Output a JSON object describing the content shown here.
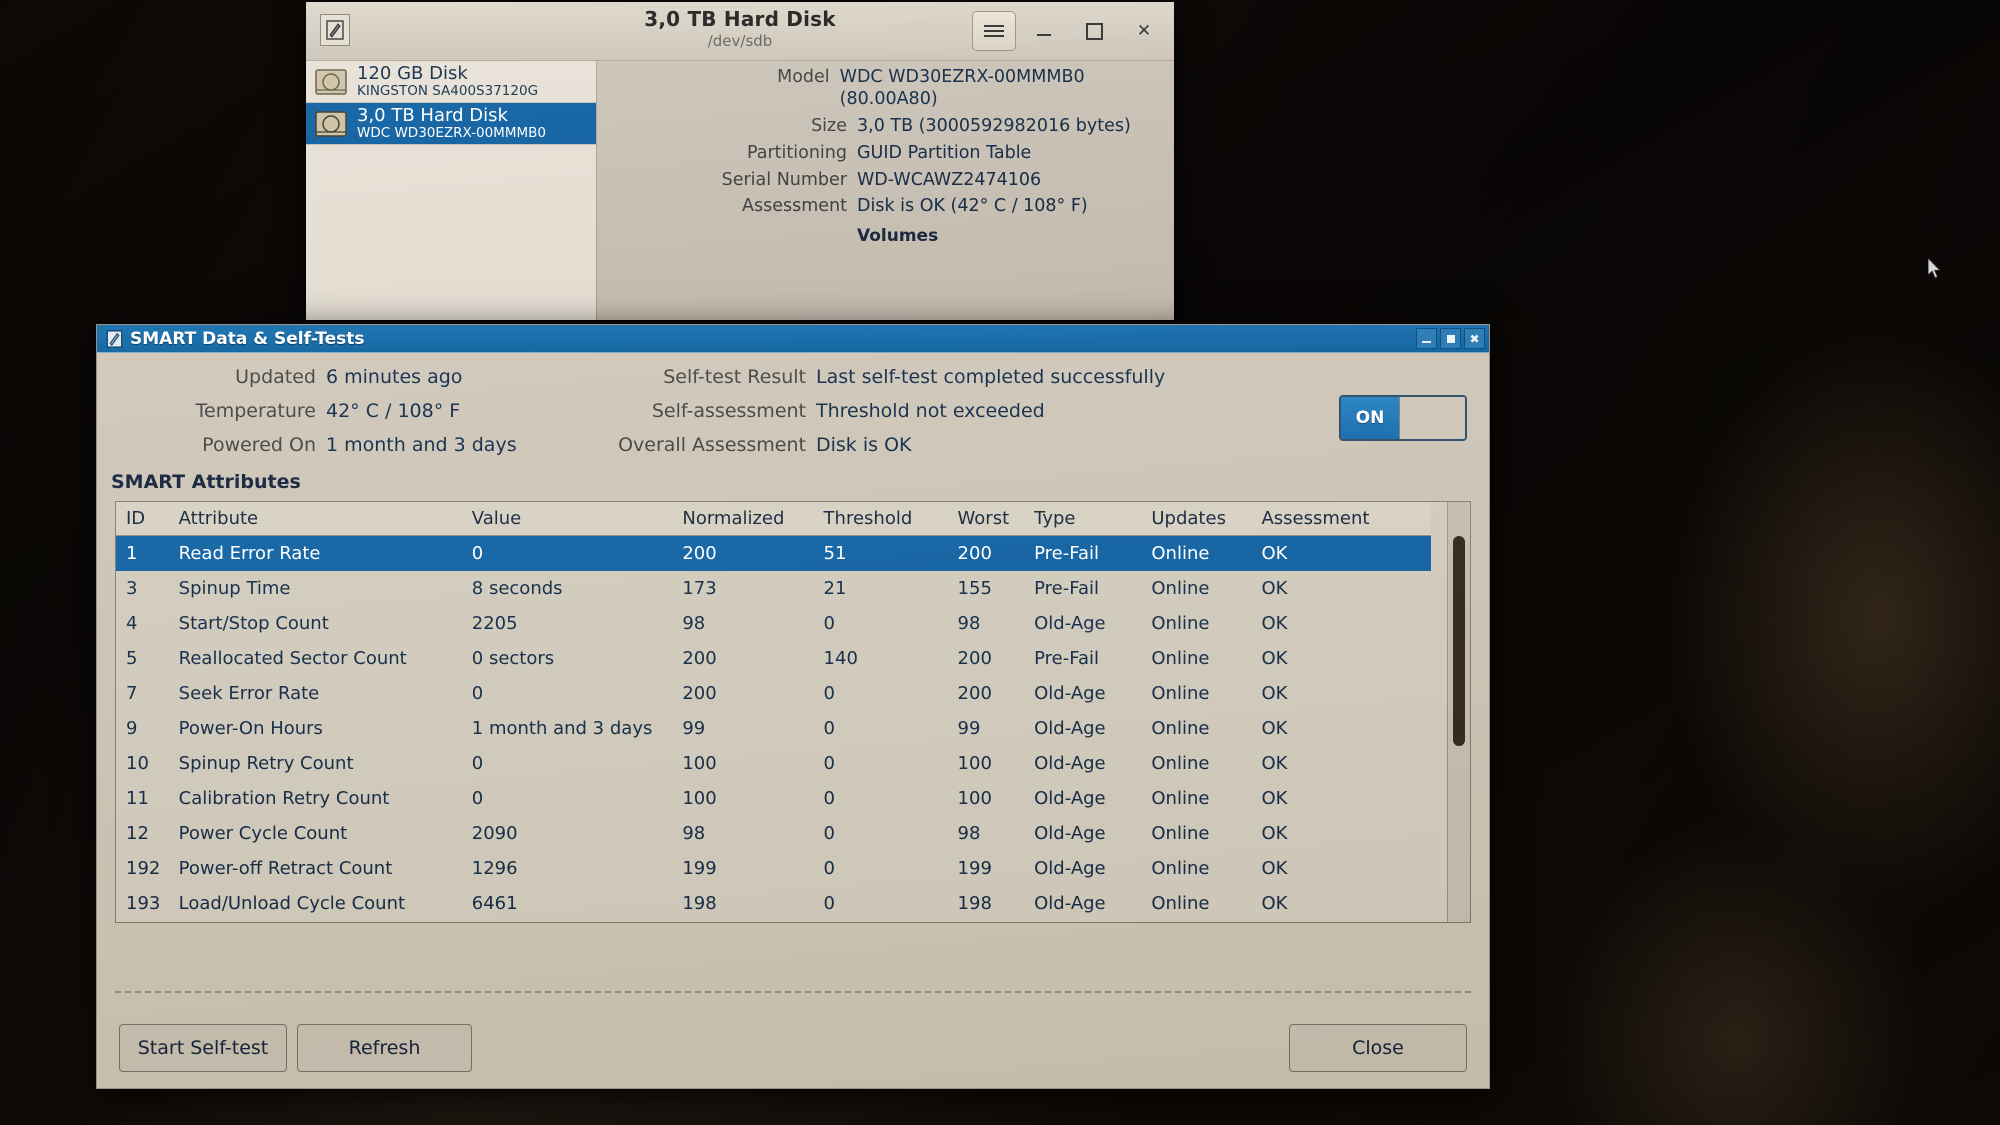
{
  "desktop": {
    "cursor_icon": "mouse-pointer-icon"
  },
  "disks_window": {
    "title": "3,0 TB Hard Disk",
    "subtitle": "/dev/sdb",
    "app_icon": "disks-app-icon",
    "titlebar_buttons": {
      "menu": "hamburger-menu-icon",
      "minimize": "minimize-icon",
      "maximize": "maximize-icon",
      "close": "close-icon"
    },
    "disk_list": [
      {
        "name": "120 GB Disk",
        "model": "KINGSTON SA400S37120G",
        "selected": false,
        "icon": "hard-disk-icon"
      },
      {
        "name": "3,0 TB Hard Disk",
        "model": "WDC WD30EZRX-00MMMB0",
        "selected": true,
        "icon": "hard-disk-icon"
      }
    ],
    "details": [
      {
        "key": "Model",
        "value": "WDC WD30EZRX-00MMMB0 (80.00A80)"
      },
      {
        "key": "Size",
        "value": "3,0 TB (3000592982016 bytes)"
      },
      {
        "key": "Partitioning",
        "value": "GUID Partition Table"
      },
      {
        "key": "Serial Number",
        "value": "WD-WCAWZ2474106"
      },
      {
        "key": "Assessment",
        "value": "Disk is OK (42° C / 108° F)"
      }
    ],
    "volumes_label": "Volumes"
  },
  "smart_dialog": {
    "title": "SMART Data & Self-Tests",
    "title_icon": "disks-app-icon",
    "titlebar_buttons": {
      "minimize": "minimize-icon",
      "maximize": "maximize-icon",
      "close": "close-icon"
    },
    "info_left": [
      {
        "key": "Updated",
        "value": "6 minutes ago"
      },
      {
        "key": "Temperature",
        "value": "42° C / 108° F"
      },
      {
        "key": "Powered On",
        "value": "1 month and 3 days"
      }
    ],
    "info_right": [
      {
        "key": "Self-test Result",
        "value": "Last self-test completed successfully"
      },
      {
        "key": "Self-assessment",
        "value": "Threshold not exceeded"
      },
      {
        "key": "Overall Assessment",
        "value": "Disk is OK"
      }
    ],
    "power_toggle": {
      "state": "ON",
      "on_label": "ON"
    },
    "attributes_heading": "SMART Attributes",
    "table": {
      "columns": [
        "ID",
        "Attribute",
        "Value",
        "Normalized",
        "Threshold",
        "Worst",
        "Type",
        "Updates",
        "Assessment"
      ],
      "rows": [
        {
          "id": "1",
          "attribute": "Read Error Rate",
          "value": "0",
          "normalized": "200",
          "threshold": "51",
          "worst": "200",
          "type": "Pre-Fail",
          "updates": "Online",
          "assessment": "OK",
          "selected": true
        },
        {
          "id": "3",
          "attribute": "Spinup Time",
          "value": "8 seconds",
          "normalized": "173",
          "threshold": "21",
          "worst": "155",
          "type": "Pre-Fail",
          "updates": "Online",
          "assessment": "OK",
          "selected": false
        },
        {
          "id": "4",
          "attribute": "Start/Stop Count",
          "value": "2205",
          "normalized": "98",
          "threshold": "0",
          "worst": "98",
          "type": "Old-Age",
          "updates": "Online",
          "assessment": "OK",
          "selected": false
        },
        {
          "id": "5",
          "attribute": "Reallocated Sector Count",
          "value": "0 sectors",
          "normalized": "200",
          "threshold": "140",
          "worst": "200",
          "type": "Pre-Fail",
          "updates": "Online",
          "assessment": "OK",
          "selected": false
        },
        {
          "id": "7",
          "attribute": "Seek Error Rate",
          "value": "0",
          "normalized": "200",
          "threshold": "0",
          "worst": "200",
          "type": "Old-Age",
          "updates": "Online",
          "assessment": "OK",
          "selected": false
        },
        {
          "id": "9",
          "attribute": "Power-On Hours",
          "value": "1 month and 3 days",
          "normalized": "99",
          "threshold": "0",
          "worst": "99",
          "type": "Old-Age",
          "updates": "Online",
          "assessment": "OK",
          "selected": false
        },
        {
          "id": "10",
          "attribute": "Spinup Retry Count",
          "value": "0",
          "normalized": "100",
          "threshold": "0",
          "worst": "100",
          "type": "Old-Age",
          "updates": "Online",
          "assessment": "OK",
          "selected": false
        },
        {
          "id": "11",
          "attribute": "Calibration Retry Count",
          "value": "0",
          "normalized": "100",
          "threshold": "0",
          "worst": "100",
          "type": "Old-Age",
          "updates": "Online",
          "assessment": "OK",
          "selected": false
        },
        {
          "id": "12",
          "attribute": "Power Cycle Count",
          "value": "2090",
          "normalized": "98",
          "threshold": "0",
          "worst": "98",
          "type": "Old-Age",
          "updates": "Online",
          "assessment": "OK",
          "selected": false
        },
        {
          "id": "192",
          "attribute": "Power-off Retract Count",
          "value": "1296",
          "normalized": "199",
          "threshold": "0",
          "worst": "199",
          "type": "Old-Age",
          "updates": "Online",
          "assessment": "OK",
          "selected": false
        },
        {
          "id": "193",
          "attribute": "Load/Unload Cycle Count",
          "value": "6461",
          "normalized": "198",
          "threshold": "0",
          "worst": "198",
          "type": "Old-Age",
          "updates": "Online",
          "assessment": "OK",
          "selected": false
        }
      ]
    },
    "buttons": {
      "start_selftest": "Start Self-test",
      "refresh": "Refresh",
      "close": "Close"
    }
  },
  "colors": {
    "selection_blue": "#1a6aa8",
    "titlebar_blue": "#1f6fae",
    "window_bg": "#cfc7b9",
    "text_dark": "#1c3350"
  }
}
